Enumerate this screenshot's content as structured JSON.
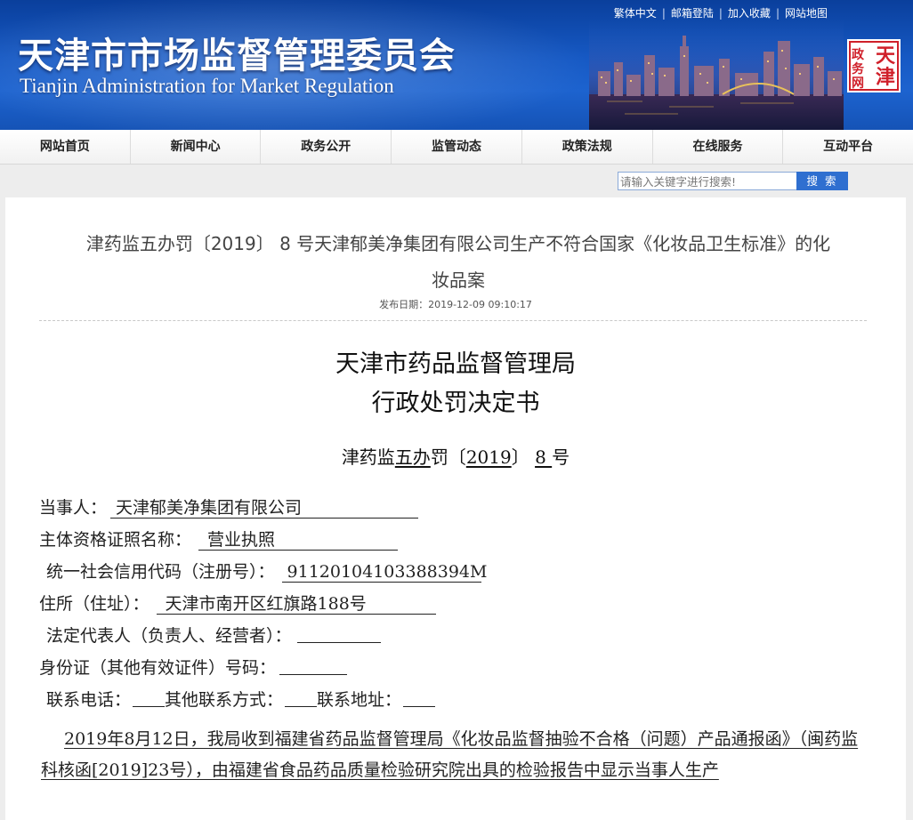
{
  "header": {
    "title_cn": "天津市市场监督管理委员会",
    "title_en": "Tianjin Administration for Market Regulation",
    "links": [
      "繁体中文",
      "邮箱登陆",
      "加入收藏",
      "网站地图"
    ],
    "seal_text": [
      "天",
      "津",
      "政",
      "务",
      "网"
    ]
  },
  "nav": {
    "items": [
      "网站首页",
      "新闻中心",
      "政务公开",
      "监管动态",
      "政策法规",
      "在线服务",
      "互动平台"
    ]
  },
  "search": {
    "placeholder": "请输入关键字进行搜索!",
    "button_label": "搜 索"
  },
  "article": {
    "title": "津药监五办罚〔2019〕 8 号天津郁美净集团有限公司生产不符合国家《化妆品卫生标准》的化妆品案",
    "publish_label": "发布日期：",
    "publish_date": "2019-12-09 09:10:17"
  },
  "document": {
    "heading_line1": "天津市药品监督管理局",
    "heading_line2": "行政处罚决定书",
    "number": {
      "prefix": "津药监",
      "agency": "五办",
      "type": "罚〔",
      "year": "2019",
      "mid": "〕 ",
      "num": "8 ",
      "suffix": "号"
    },
    "fields": {
      "party_label": "当事人：",
      "party_value": "天津郁美净集团有限公司",
      "cert_label": "主体资格证照名称：",
      "cert_value": "营业执照",
      "credit_label": "统一社会信用代码（注册号）：",
      "credit_value": "91120104103388394M",
      "address_label": "住所（住址）：",
      "address_value": "天津市南开区红旗路188号",
      "legal_label": "法定代表人（负责人、经营者）：",
      "id_label": "身份证（其他有效证件）号码：",
      "phone_label": "联系电话：",
      "other_label": "其他联系方式：",
      "contact_addr_label": "联系地址："
    },
    "body": "2019年8月12日，我局收到福建省药品监督管理局《化妆品监督抽验不合格（问题）产品通报函》（闽药监科核函[2019]23号），由福建省食品药品质量检验研究院出具的检验报告中显示当事人生产"
  },
  "colors": {
    "header_blue": "#1659c4",
    "search_button": "#2f6fd0"
  }
}
